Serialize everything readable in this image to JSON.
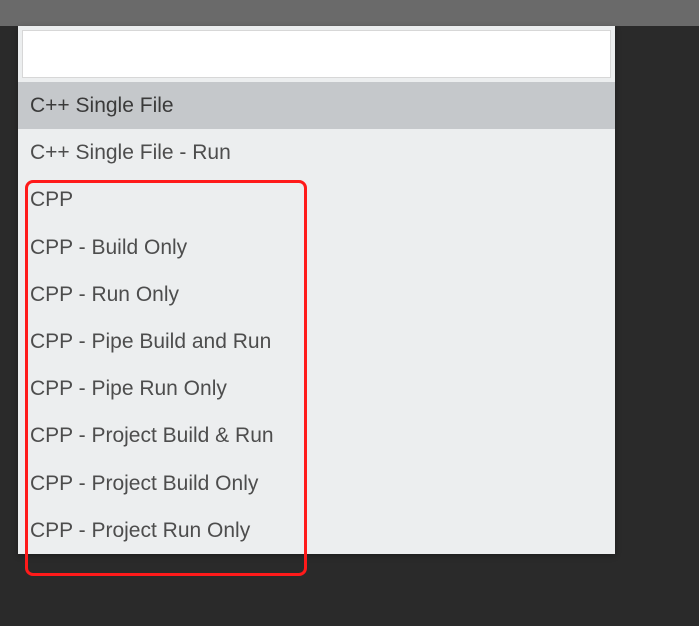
{
  "search": {
    "value": "",
    "placeholder": ""
  },
  "items": [
    {
      "label": "C++ Single File",
      "selected": true
    },
    {
      "label": "C++ Single File - Run",
      "selected": false
    },
    {
      "label": "CPP",
      "selected": false
    },
    {
      "label": "CPP - Build Only",
      "selected": false
    },
    {
      "label": "CPP - Run Only",
      "selected": false
    },
    {
      "label": "CPP - Pipe Build and Run",
      "selected": false
    },
    {
      "label": "CPP - Pipe Run Only",
      "selected": false
    },
    {
      "label": "CPP - Project Build & Run",
      "selected": false
    },
    {
      "label": "CPP - Project Build Only",
      "selected": false
    },
    {
      "label": "CPP - Project Run Only",
      "selected": false
    }
  ]
}
